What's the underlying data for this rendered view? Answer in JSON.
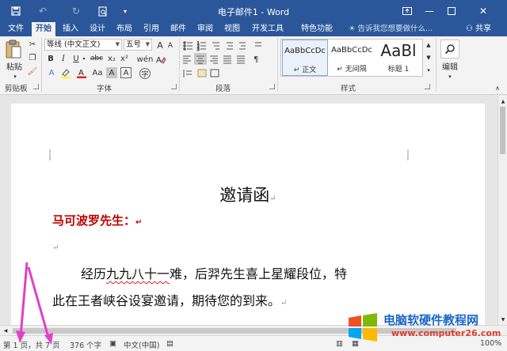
{
  "window": {
    "title": "电子邮件1 - Word"
  },
  "ribbon_tabs": [
    "文件",
    "开始",
    "插入",
    "设计",
    "布局",
    "引用",
    "邮件",
    "审阅",
    "视图",
    "开发工具",
    "特色功能"
  ],
  "tell_me": "告诉我您想要做什么...",
  "share_label": "共享",
  "clipboard": {
    "paste_label": "粘贴",
    "group_label": "剪贴板"
  },
  "font": {
    "font_name": "等线 (中文正文)",
    "font_size": "五号",
    "group_label": "字体",
    "size_grow": "A",
    "size_shrink": "A",
    "format_buttons": [
      "B",
      "I",
      "U",
      "abc",
      "x₂",
      "x²"
    ]
  },
  "paragraph": {
    "group_label": "段落"
  },
  "styles": {
    "group_label": "样式",
    "items": [
      {
        "preview": "AaBbCcDc",
        "name": "↵ 正文"
      },
      {
        "preview": "AaBbCcDc",
        "name": "↵ 无间隔"
      },
      {
        "preview": "AaBl",
        "name": "标题 1"
      }
    ]
  },
  "editing": {
    "label": "编辑"
  },
  "document": {
    "heading": "邀请函",
    "salutation": "马可波罗先生：",
    "para1_a": "经历",
    "para1_squiggle": "九九八十一",
    "para1_b": "难，后羿先生喜上星耀段位，特",
    "para2": "此在王者峡谷设宴邀请，期待您的到来。",
    "para_mark": "↵"
  },
  "status": {
    "page": "第 1 页，共 7 页",
    "words": "376 个字",
    "language": "中文(中国)",
    "zoom": "100%"
  },
  "watermark": {
    "line1": "电脑软硬件教程网",
    "line2": "www.computer26.com"
  },
  "colors": {
    "accent": "#2b579a",
    "salutation": "#c00000",
    "annotation_arrow": "#e040c8"
  }
}
